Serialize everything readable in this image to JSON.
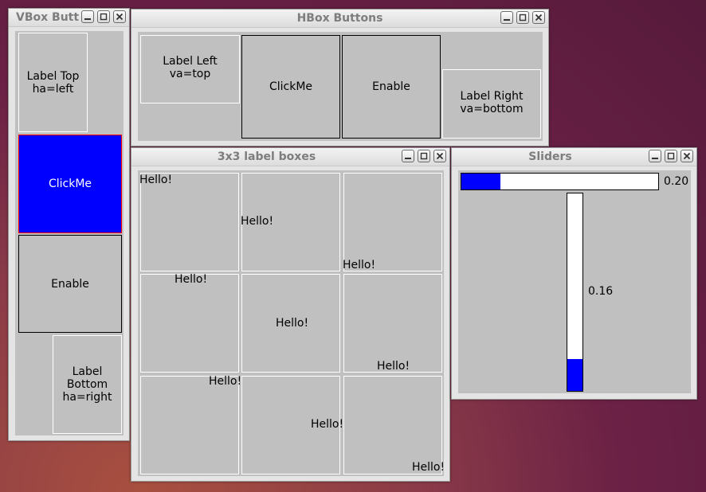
{
  "windows": {
    "vbox": {
      "title": "VBox Butt",
      "label_top": [
        "Label Top",
        "ha=left"
      ],
      "clickme": "ClickMe",
      "enable": "Enable",
      "label_bottom": [
        "Label Bottom",
        "ha=right"
      ]
    },
    "hbox": {
      "title": "HBox Buttons",
      "label_left": [
        "Label Left",
        "va=top"
      ],
      "clickme": "ClickMe",
      "enable": "Enable",
      "label_right": [
        "Label Right",
        "va=bottom"
      ]
    },
    "grid": {
      "title": "3x3 label boxes",
      "cells": [
        "Hello!",
        "Hello!",
        "Hello!",
        "Hello!",
        "Hello!",
        "Hello!",
        "Hello!",
        "Hello!",
        "Hello!"
      ]
    },
    "sliders": {
      "title": "Sliders",
      "horizontal_value": 0.2,
      "horizontal_label": "0.20",
      "vertical_value": 0.16,
      "vertical_label": "0.16"
    }
  },
  "colors": {
    "panel": "#c0c0c0",
    "active_button": "#0000ff",
    "slider_fill": "#0000ff",
    "desktop": "#6b2145"
  },
  "icons": [
    "minimize-icon",
    "maximize-icon",
    "close-icon"
  ]
}
